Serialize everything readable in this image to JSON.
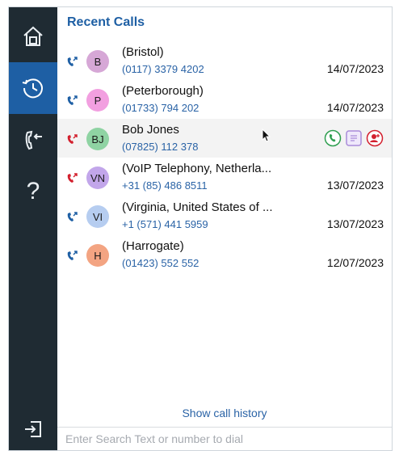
{
  "panel_title": "Recent Calls",
  "calls": [
    {
      "initials": "B",
      "avatar_color": "#d6a7d6",
      "name": "(Bristol)",
      "number": "(0117) 3379 4202",
      "date": "14/07/2023",
      "direction": "outgoing",
      "direction_color": "#1e5fa4"
    },
    {
      "initials": "P",
      "avatar_color": "#f29fe0",
      "name": "(Peterborough)",
      "number": "(01733) 794 202",
      "date": "14/07/2023",
      "direction": "outgoing",
      "direction_color": "#1e5fa4"
    },
    {
      "initials": "BJ",
      "avatar_color": "#8fd3a3",
      "name": "Bob Jones",
      "number": "(07825) 112 378",
      "date": "",
      "direction": "missed",
      "direction_color": "#d3202e"
    },
    {
      "initials": "VN",
      "avatar_color": "#c2a6ea",
      "name": "(VoIP Telephony, Netherla...",
      "number": "+31 (85) 486 8511",
      "date": "13/07/2023",
      "direction": "missed",
      "direction_color": "#d3202e"
    },
    {
      "initials": "VI",
      "avatar_color": "#b6cdf0",
      "name": "(Virginia, United States of ...",
      "number": "+1 (571) 441 5959",
      "date": "13/07/2023",
      "direction": "outgoing",
      "direction_color": "#1e5fa4"
    },
    {
      "initials": "H",
      "avatar_color": "#f3a482",
      "name": "(Harrogate)",
      "number": "(01423) 552 552",
      "date": "12/07/2023",
      "direction": "outgoing",
      "direction_color": "#1e5fa4"
    }
  ],
  "show_history_label": "Show call history",
  "search_placeholder": "Enter Search Text or number to dial",
  "sidebar_icons": [
    "home-icon",
    "recent-calls-icon",
    "transfer-icon",
    "help-icon",
    "logout-icon"
  ],
  "help_glyph": "?",
  "colors": {
    "sidebar": "#1f2b33",
    "active": "#1e5fa4",
    "accent": "#1e5fa4",
    "link": "#2a63a6"
  }
}
